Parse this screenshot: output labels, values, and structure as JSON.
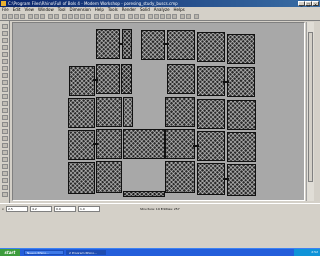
{
  "window": {
    "title": "C:\\Program Files\\Rhino\\Full of Bols 4 - Modern Workshop - poresing_study_buscs.cmp"
  },
  "menu": {
    "items": [
      "File",
      "Edit",
      "View",
      "Window",
      "Tool",
      "Dimension",
      "Help",
      "Tools",
      "Render",
      "Solid",
      "Analyze",
      "Helps"
    ]
  },
  "status": {
    "xy_label": "x",
    "x_value": "2.5",
    "y_value": "4.2",
    "z_value": "0.0",
    "w_value": "1.0",
    "info": "Structure: 19 Entities: 257"
  },
  "taskbar": {
    "start_label": "start",
    "tasks": [
      {
        "label": "Nuevo Rhino..."
      },
      {
        "label": "2 Program Rhino..."
      }
    ],
    "tray_time": "2:52"
  },
  "colors": {
    "titlebar": "#0a246a",
    "canvas_bg": "#a8a8a8",
    "taskbar": "#245edb",
    "start_button": "#3c9c3c"
  }
}
